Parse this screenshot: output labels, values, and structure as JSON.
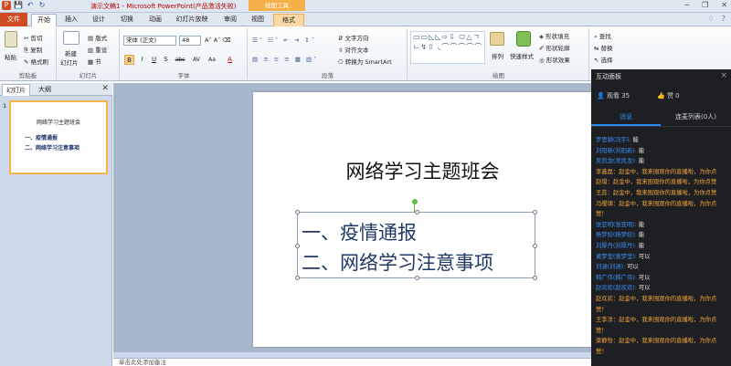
{
  "titlebar": {
    "doc_title": "演示文稿1 - Microsoft PowerPoint(产品激活失败)",
    "context_group": "绘图工具",
    "quick_access": [
      "P",
      "💾",
      "↶",
      "↻"
    ],
    "controls": [
      "─",
      "❐",
      "✕"
    ]
  },
  "tabs": [
    "文件",
    "开始",
    "插入",
    "设计",
    "切换",
    "动画",
    "幻灯片放映",
    "审阅",
    "视图",
    "格式"
  ],
  "ribbon": {
    "clipboard": {
      "paste": "粘贴",
      "cut": "剪切",
      "copy": "复制",
      "painter": "格式刷",
      "label": "剪贴板"
    },
    "slides": {
      "new_slide": "新建",
      "new_slide2": "幻灯片",
      "layout": "版式",
      "reset": "重设",
      "section": "节",
      "label": "幻灯片"
    },
    "font": {
      "name": "宋体 (正文)",
      "size": "48",
      "label": "字体",
      "buttons": [
        "B",
        "I",
        "U",
        "S",
        "abc",
        "AV",
        "Aa",
        "A"
      ]
    },
    "paragraph": {
      "text_direction": "文字方向",
      "align_text": "对齐文本",
      "smartart": "转换为 SmartArt",
      "label": "段落"
    },
    "drawing": {
      "shapes_row": "▭▭◺◺⇨⇩ ⬭△ㄱㄴ↯⇧ ◟⌒⌒⌒⌒⌒",
      "arrange": "排列",
      "quick_styles": "快速样式",
      "fill": "形状填充",
      "outline": "形状轮廓",
      "effects": "形状效果",
      "label": "绘图"
    },
    "editing": {
      "find": "查找",
      "replace": "替换",
      "select": "选择",
      "label": "编辑"
    }
  },
  "left_pane": {
    "tabs": [
      "幻灯片",
      "大纲"
    ],
    "close": "✕",
    "slide_number": "1",
    "thumb_title": "网络学习主题班会",
    "thumb_items": [
      "一、疫情通报",
      "二、网络学习注意事项"
    ]
  },
  "slide": {
    "title": "网络学习主题班会",
    "lines": [
      "一、疫情通报",
      "二、网络学习注意事项"
    ]
  },
  "notes_placeholder": "单击此处添加备注",
  "panel": {
    "title": "互动面板",
    "close": "×",
    "viewers": "观看 35",
    "likes": "赞 0",
    "tab_messages": "消息",
    "tab_mic": "连麦列表(0人)",
    "messages": [
      {
        "user": "罗思颖(冯宇):",
        "text": " 能",
        "type": "chat"
      },
      {
        "user": "刘阳新(刘阳新):",
        "text": " 能",
        "type": "chat"
      },
      {
        "user": "吴凯龙(吴凯龙):",
        "text": " 能",
        "type": "chat"
      },
      {
        "user": "",
        "text": "李鑫磊：赵金中，我来围观你的直播啦，为你点",
        "type": "warn"
      },
      {
        "user": "",
        "text": "赵璟：赵金中，我来围观你的直播啦，为你点赞",
        "type": "warn"
      },
      {
        "user": "",
        "text": "王蕊：赵金中，我来围观你的直播啦，为你点赞",
        "type": "warn"
      },
      {
        "user": "",
        "text": "冯缨璃：赵金中，我来围观你的直播啦，为你点",
        "type": "warn"
      },
      {
        "user": "",
        "text": "赞！",
        "type": "warn"
      },
      {
        "user": "张亚明(张亚明):",
        "text": " 能",
        "type": "chat"
      },
      {
        "user": "杨梦姣(杨梦姣):",
        "text": " 能",
        "type": "chat"
      },
      {
        "user": "刘厚丹(刘厚丹):",
        "text": " 能",
        "type": "chat"
      },
      {
        "user": "黄梦莹(黄梦莹):",
        "text": " 可以",
        "type": "chat"
      },
      {
        "user": "刘涵(刘涵):",
        "text": " 可以",
        "type": "chat"
      },
      {
        "user": "韩广伟(韩广伟):",
        "text": " 可以",
        "type": "chat"
      },
      {
        "user": "赵欢欢(赵欢欢):",
        "text": " 可以",
        "type": "chat"
      },
      {
        "user": "",
        "text": "赵欢欢：赵金中，我来围观你的直播啦，为你点",
        "type": "warn"
      },
      {
        "user": "",
        "text": "赞！",
        "type": "warn"
      },
      {
        "user": "",
        "text": "王李洋：赵金中，我来围观你的直播啦，为你点",
        "type": "warn"
      },
      {
        "user": "",
        "text": "赞！",
        "type": "warn"
      },
      {
        "user": "",
        "text": "梁静怡：赵金中，我来围观你的直播啦，为你点",
        "type": "warn"
      },
      {
        "user": "",
        "text": "赞！",
        "type": "warn"
      }
    ]
  },
  "colors": {
    "accent": "#2b8df7",
    "file_tab": "#d04a24",
    "context_tab": "#f6b04a",
    "panel_bg": "#1d1f22"
  }
}
